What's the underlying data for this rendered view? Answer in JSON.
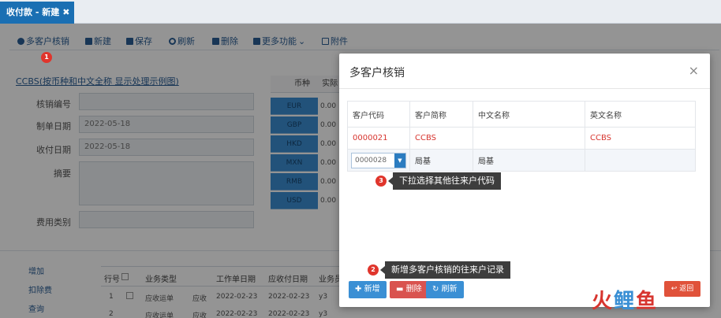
{
  "tab": {
    "label": "收付款 - 新建",
    "close": "✖"
  },
  "toolbar": {
    "multi": "多客户核销",
    "new": "新建",
    "save": "保存",
    "refresh": "刷新",
    "delete": "删除",
    "more": "更多功能",
    "more_caret": "⌄",
    "attach": "附件"
  },
  "form": {
    "note": "CCBS(按币种和中文全称 显示处理示例图)",
    "labels": [
      "核销编号",
      "制单日期",
      "收付日期",
      "摘要",
      "费用类别"
    ],
    "values": {
      "make_date": "2022-05-18",
      "pay_date": "2022-05-18"
    }
  },
  "currency": {
    "headers": [
      "币种",
      "实际"
    ],
    "codes": [
      "EUR",
      "GBP",
      "HKD",
      "MXN",
      "RMB",
      "USD"
    ],
    "values": [
      "0.00",
      "0.00",
      "0.00",
      "0.00",
      "0.00",
      "0.00"
    ]
  },
  "sidenav": [
    "增加",
    "扣除费",
    "查询"
  ],
  "grid": {
    "headers": [
      "行号",
      "业务类型",
      "工作单日期",
      "应收付日期",
      "业务员"
    ],
    "rows": [
      {
        "no": "1",
        "type": "应收运单",
        "x": "应收",
        "d1": "2022-02-23",
        "d2": "2022-02-23",
        "who": "y3"
      },
      {
        "no": "2",
        "type": "应收运单",
        "x": "应收",
        "d1": "2022-02-23",
        "d2": "2022-02-23",
        "who": "y3"
      }
    ]
  },
  "modal": {
    "title": "多客户核销",
    "close": "×",
    "headers": [
      "客户代码",
      "客户简称",
      "中文名称",
      "英文名称"
    ],
    "rows": [
      {
        "code": "0000021",
        "short": "CCBS",
        "cn": "",
        "en": "CCBS"
      },
      {
        "code": "0000028",
        "short": "局基",
        "cn": "局基",
        "en": ""
      }
    ],
    "dropdown_glyph": "▼",
    "buttons": {
      "add": "新增",
      "delete": "删除",
      "refresh": "刷新"
    },
    "return": "返回"
  },
  "annotations": [
    {
      "n": "1"
    },
    {
      "n": "2",
      "text": "新增多客户核销的往来户记录"
    },
    {
      "n": "3",
      "text": "下拉选择其他往来户代码"
    }
  ],
  "watermark": {
    "text": "火鲤鱼",
    "colors": [
      "#d7352f",
      "#3a8fd4"
    ]
  }
}
